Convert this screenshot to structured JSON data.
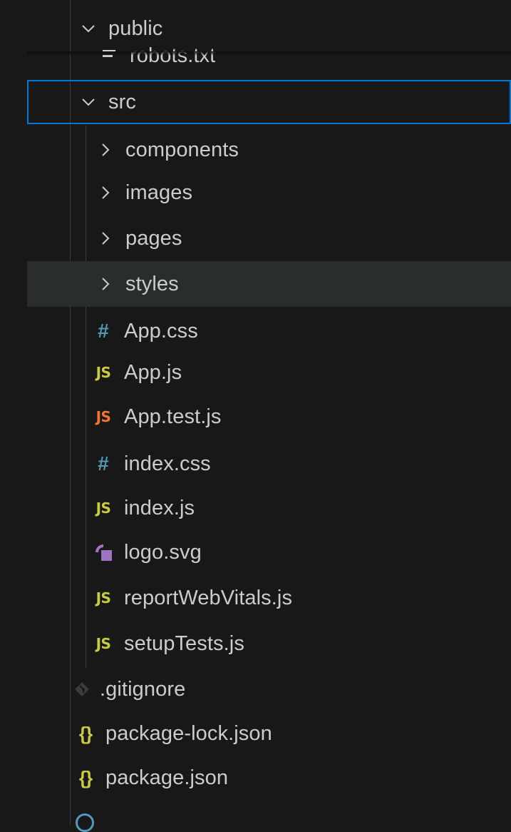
{
  "explorer": {
    "items": [
      {
        "label": "public",
        "kind": "folder-open",
        "icon": "chevron-down-icon"
      },
      {
        "label": "robots.txt",
        "kind": "file",
        "icon": "text-file-icon"
      },
      {
        "label": "src",
        "kind": "folder-open",
        "icon": "chevron-down-icon"
      },
      {
        "label": "components",
        "kind": "folder-closed",
        "icon": "chevron-right-icon"
      },
      {
        "label": "images",
        "kind": "folder-closed",
        "icon": "chevron-right-icon"
      },
      {
        "label": "pages",
        "kind": "folder-closed",
        "icon": "chevron-right-icon"
      },
      {
        "label": "styles",
        "kind": "folder-closed",
        "icon": "chevron-right-icon"
      },
      {
        "label": "App.css",
        "kind": "file",
        "icon": "css-file-icon",
        "badge": "#"
      },
      {
        "label": "App.js",
        "kind": "file",
        "icon": "js-file-icon",
        "badge": "JS"
      },
      {
        "label": "App.test.js",
        "kind": "file",
        "icon": "js-test-file-icon",
        "badge": "JS"
      },
      {
        "label": "index.css",
        "kind": "file",
        "icon": "css-file-icon",
        "badge": "#"
      },
      {
        "label": "index.js",
        "kind": "file",
        "icon": "js-file-icon",
        "badge": "JS"
      },
      {
        "label": "logo.svg",
        "kind": "file",
        "icon": "svg-file-icon"
      },
      {
        "label": "reportWebVitals.js",
        "kind": "file",
        "icon": "js-file-icon",
        "badge": "JS"
      },
      {
        "label": "setupTests.js",
        "kind": "file",
        "icon": "js-file-icon",
        "badge": "JS"
      },
      {
        "label": ".gitignore",
        "kind": "file",
        "icon": "git-file-icon"
      },
      {
        "label": "package-lock.json",
        "kind": "file",
        "icon": "json-file-icon",
        "badge": "{}"
      },
      {
        "label": "package.json",
        "kind": "file",
        "icon": "json-file-icon",
        "badge": "{}"
      }
    ]
  },
  "colors": {
    "background": "#181818",
    "hover_row": "#2a2d2e",
    "focus_outline": "#0078d4",
    "js_badge": "#cbcb41",
    "js_test_badge": "#f1762f",
    "css_badge": "#519aba",
    "svg_icon": "#a074c4"
  }
}
